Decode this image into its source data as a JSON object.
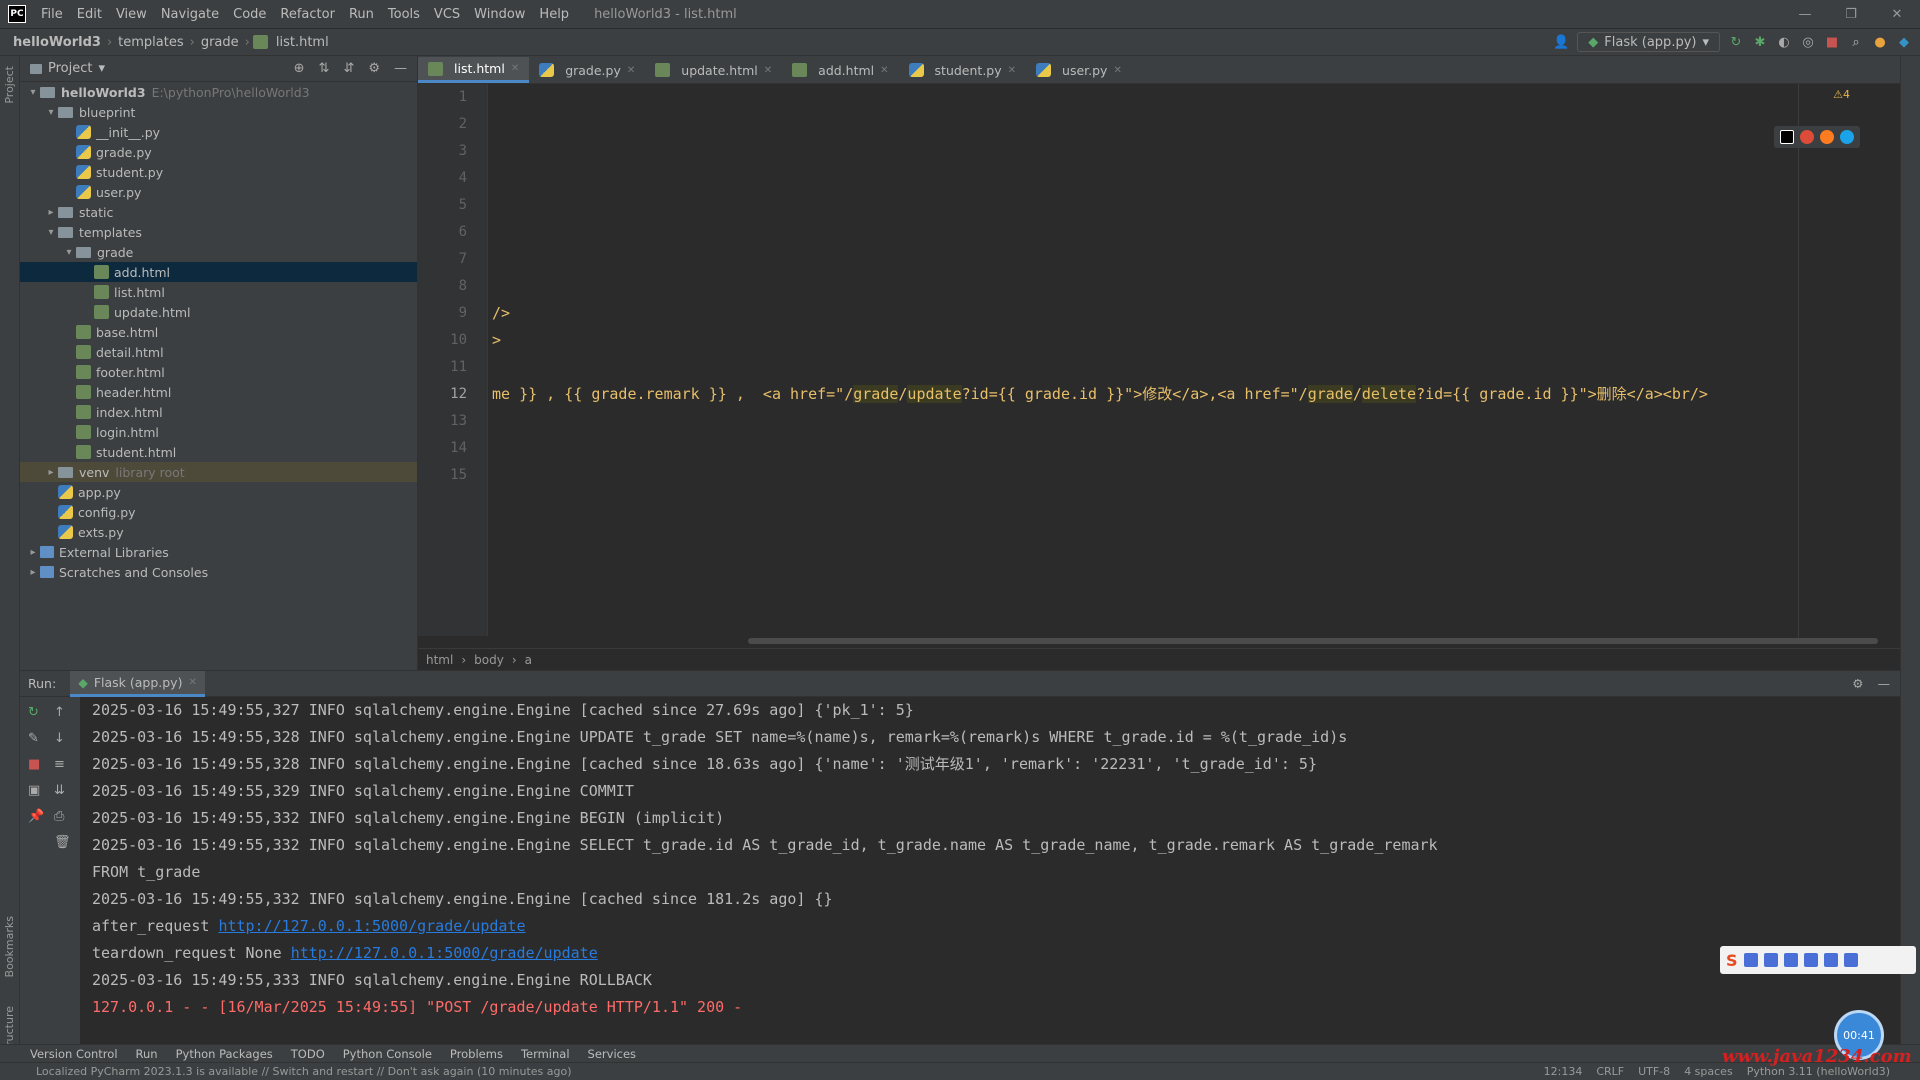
{
  "menubar": {
    "logo": "PC",
    "items": [
      "File",
      "Edit",
      "View",
      "Navigate",
      "Code",
      "Refactor",
      "Run",
      "Tools",
      "VCS",
      "Window",
      "Help"
    ],
    "window_title": "helloWorld3 - list.html",
    "controls": [
      "—",
      "❐",
      "✕"
    ]
  },
  "navbar": {
    "crumbs": [
      "helloWorld3",
      "templates",
      "grade",
      "list.html"
    ],
    "run_config": "Flask (app.py)"
  },
  "left_strip": {
    "project_label": "Project",
    "structure_label": "Structure",
    "bookmarks_label": "Bookmarks"
  },
  "project": {
    "title": "Project",
    "rows": [
      {
        "label": "helloWorld3",
        "extra": "E:\\pythonPro\\helloWorld3",
        "icon": "folder",
        "indent": 0,
        "arrow": "▾",
        "bold": true
      },
      {
        "label": "blueprint",
        "icon": "folder",
        "indent": 1,
        "arrow": "▾"
      },
      {
        "label": "__init__.py",
        "icon": "py",
        "indent": 2,
        "arrow": ""
      },
      {
        "label": "grade.py",
        "icon": "py",
        "indent": 2,
        "arrow": ""
      },
      {
        "label": "student.py",
        "icon": "py",
        "indent": 2,
        "arrow": ""
      },
      {
        "label": "user.py",
        "icon": "py",
        "indent": 2,
        "arrow": ""
      },
      {
        "label": "static",
        "icon": "folder",
        "indent": 1,
        "arrow": "▸"
      },
      {
        "label": "templates",
        "icon": "folder",
        "indent": 1,
        "arrow": "▾"
      },
      {
        "label": "grade",
        "icon": "folder",
        "indent": 2,
        "arrow": "▾"
      },
      {
        "label": "add.html",
        "icon": "html",
        "indent": 3,
        "arrow": "",
        "selected": true
      },
      {
        "label": "list.html",
        "icon": "html",
        "indent": 3,
        "arrow": ""
      },
      {
        "label": "update.html",
        "icon": "html",
        "indent": 3,
        "arrow": ""
      },
      {
        "label": "base.html",
        "icon": "html",
        "indent": 2,
        "arrow": ""
      },
      {
        "label": "detail.html",
        "icon": "html",
        "indent": 2,
        "arrow": ""
      },
      {
        "label": "footer.html",
        "icon": "html",
        "indent": 2,
        "arrow": ""
      },
      {
        "label": "header.html",
        "icon": "html",
        "indent": 2,
        "arrow": ""
      },
      {
        "label": "index.html",
        "icon": "html",
        "indent": 2,
        "arrow": ""
      },
      {
        "label": "login.html",
        "icon": "html",
        "indent": 2,
        "arrow": ""
      },
      {
        "label": "student.html",
        "icon": "html",
        "indent": 2,
        "arrow": ""
      },
      {
        "label": "venv",
        "extra": "library root",
        "icon": "folder",
        "indent": 1,
        "arrow": "▸",
        "highlight": true
      },
      {
        "label": "app.py",
        "icon": "py",
        "indent": 1,
        "arrow": ""
      },
      {
        "label": "config.py",
        "icon": "py",
        "indent": 1,
        "arrow": ""
      },
      {
        "label": "exts.py",
        "icon": "py",
        "indent": 1,
        "arrow": ""
      },
      {
        "label": "External Libraries",
        "icon": "lib",
        "indent": 0,
        "arrow": "▸"
      },
      {
        "label": "Scratches and Consoles",
        "icon": "lib",
        "indent": 0,
        "arrow": "▸"
      }
    ]
  },
  "editor": {
    "tabs": [
      {
        "label": "list.html",
        "active": true
      },
      {
        "label": "grade.py"
      },
      {
        "label": "update.html"
      },
      {
        "label": "add.html"
      },
      {
        "label": "student.py"
      },
      {
        "label": "user.py"
      }
    ],
    "line_numbers": [
      "1",
      "2",
      "3",
      "4",
      "5",
      "6",
      "7",
      "8",
      "9",
      "10",
      "11",
      "12",
      "13",
      "14",
      "15"
    ],
    "current_line": "12",
    "lines": [
      "",
      "",
      "",
      "",
      "",
      "",
      "",
      "",
      "/>",
      ">",
      "",
      "",
      "",
      "",
      ""
    ],
    "line12": {
      "p1": "me }} , {{ grade.remark }} ,  <a href=\"/",
      "m1": "grade",
      "p2": "/",
      "m2": "update",
      "p3": "?id={{ grade.id }}\">修改</a>,<a href=\"/",
      "m3": "grade",
      "p4": "/",
      "m4": "delete",
      "p5": "?id={{ grade.id }}\">删除</a><br/>"
    },
    "warning": "⚠4",
    "breadcrumb": [
      "html",
      "body",
      "a"
    ]
  },
  "run": {
    "label": "Run:",
    "tab": "Flask (app.py)",
    "console": [
      {
        "text": "2025-03-16 15:49:55,327 INFO sqlalchemy.engine.Engine [cached since 27.69s ago] {'pk_1': 5}",
        "type": "normal"
      },
      {
        "text": "2025-03-16 15:49:55,328 INFO sqlalchemy.engine.Engine UPDATE t_grade SET name=%(name)s, remark=%(remark)s WHERE t_grade.id = %(t_grade_id)s",
        "type": "normal"
      },
      {
        "text": "2025-03-16 15:49:55,328 INFO sqlalchemy.engine.Engine [cached since 18.63s ago] {'name': '测试年级1', 'remark': '22231', 't_grade_id': 5}",
        "type": "normal"
      },
      {
        "text": "2025-03-16 15:49:55,329 INFO sqlalchemy.engine.Engine COMMIT",
        "type": "normal"
      },
      {
        "text": "2025-03-16 15:49:55,332 INFO sqlalchemy.engine.Engine BEGIN (implicit)",
        "type": "normal"
      },
      {
        "text": "2025-03-16 15:49:55,332 INFO sqlalchemy.engine.Engine SELECT t_grade.id AS t_grade_id, t_grade.name AS t_grade_name, t_grade.remark AS t_grade_remark",
        "type": "normal"
      },
      {
        "text": "FROM t_grade",
        "type": "normal"
      },
      {
        "text": "2025-03-16 15:49:55,332 INFO sqlalchemy.engine.Engine [cached since 181.2s ago] {}",
        "type": "normal"
      },
      {
        "text": "after_request ",
        "link": "http://127.0.0.1:5000/grade/update",
        "type": "link"
      },
      {
        "text": "teardown_request None ",
        "link": "http://127.0.0.1:5000/grade/update",
        "type": "link"
      },
      {
        "text": "2025-03-16 15:49:55,333 INFO sqlalchemy.engine.Engine ROLLBACK",
        "type": "normal"
      },
      {
        "text": "127.0.0.1 - - [16/Mar/2025 15:49:55] \"POST /grade/update HTTP/1.1\" 200 -",
        "type": "err"
      }
    ]
  },
  "bottom_tabs": [
    "Version Control",
    "Run",
    "Python Packages",
    "TODO",
    "Python Console",
    "Problems",
    "Terminal",
    "Services"
  ],
  "status": {
    "message": "Localized PyCharm 2023.1.3 is available // Switch and restart // Don't ask again (10 minutes ago)",
    "right": [
      "12:134",
      "CRLF",
      "UTF-8",
      "4 spaces",
      "Python 3.11 (helloWorld3)"
    ]
  },
  "overlay": {
    "ime": "S",
    "timer": "00:41",
    "watermark": "www.java1234.com"
  }
}
